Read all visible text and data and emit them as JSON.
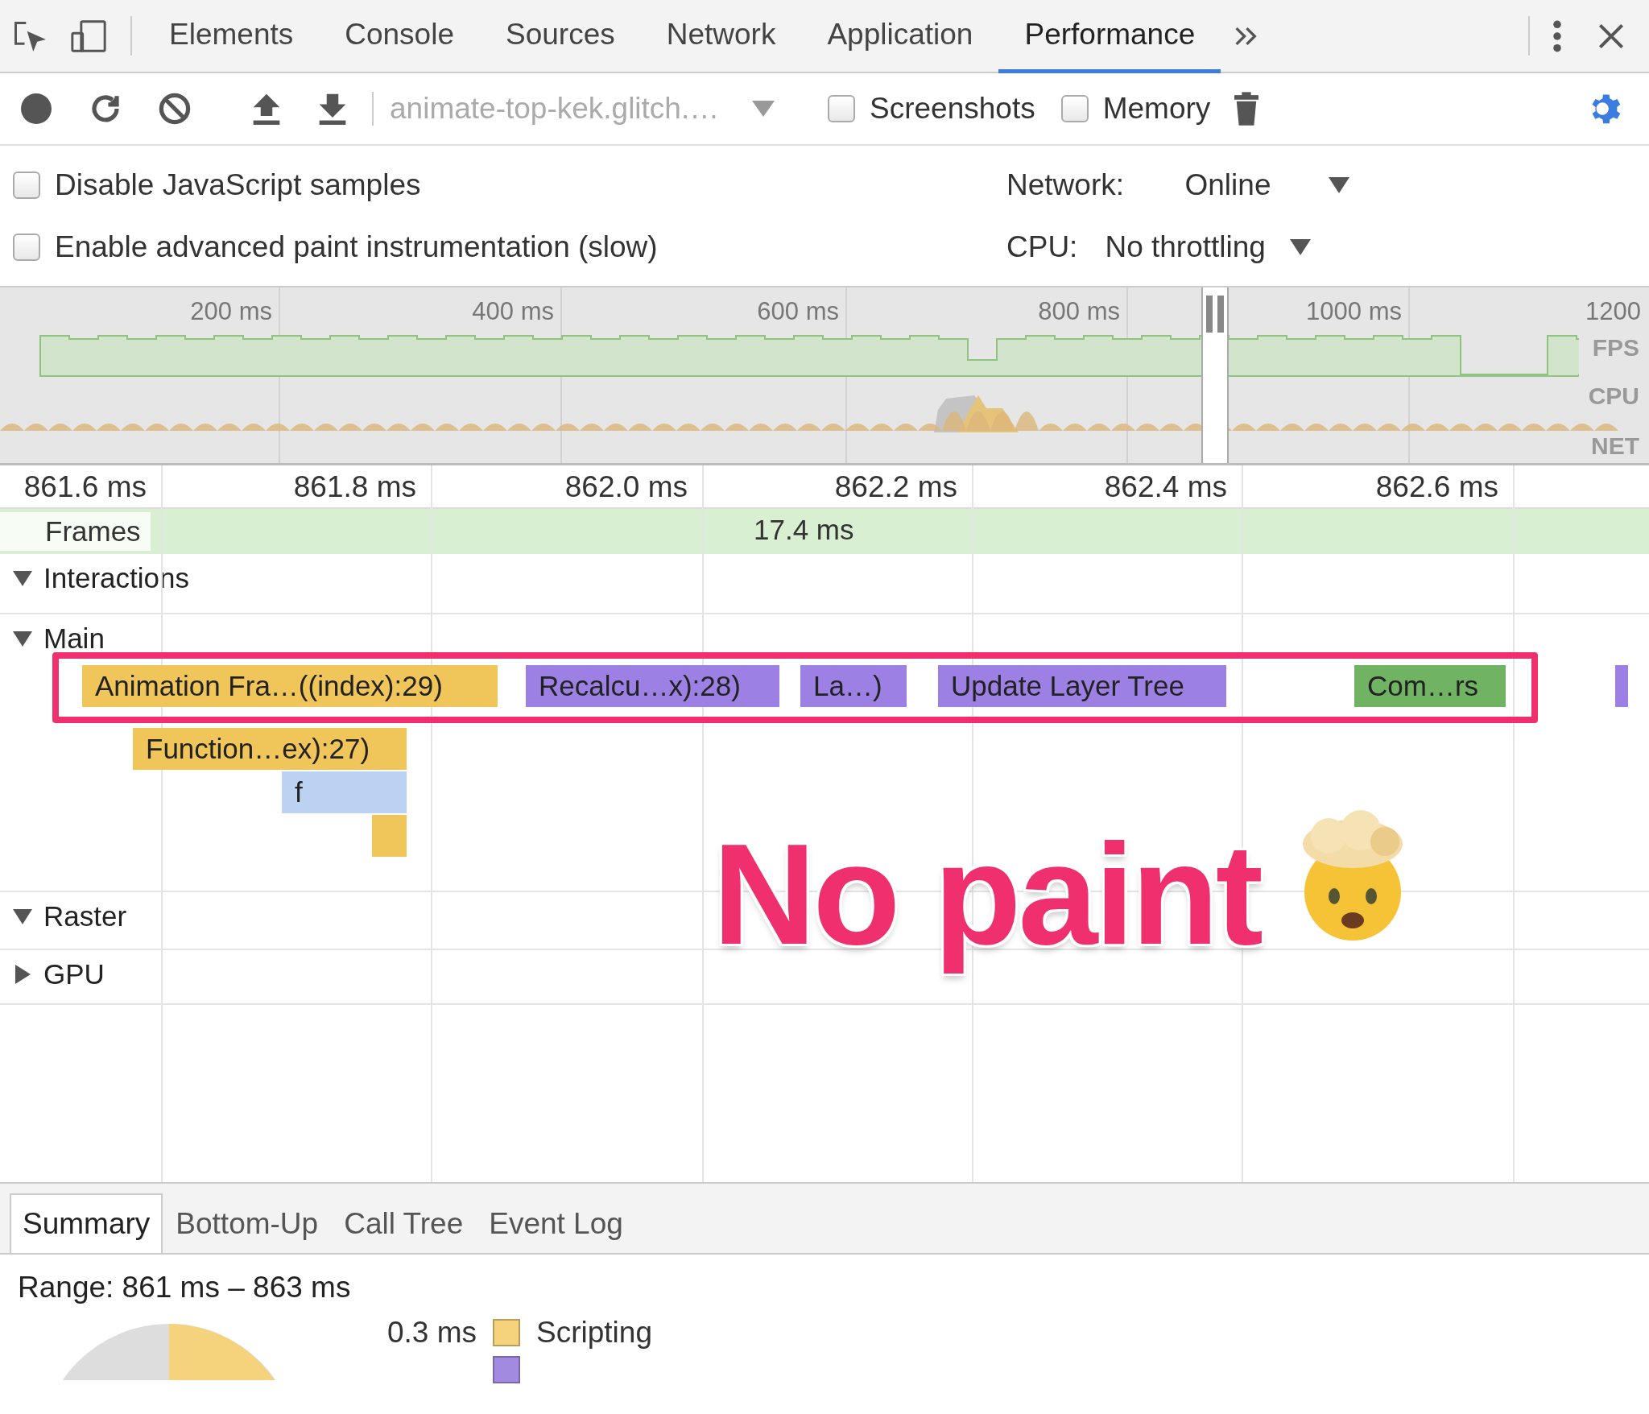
{
  "tabs": [
    {
      "label": "Elements",
      "selected": false
    },
    {
      "label": "Console",
      "selected": false
    },
    {
      "label": "Sources",
      "selected": false
    },
    {
      "label": "Network",
      "selected": false
    },
    {
      "label": "Application",
      "selected": false
    },
    {
      "label": "Performance",
      "selected": true
    }
  ],
  "toolbar": {
    "url": "animate-top-kek.glitch.…",
    "checkboxes": [
      {
        "label": "Screenshots",
        "checked": false
      },
      {
        "label": "Memory",
        "checked": false
      }
    ]
  },
  "settings": {
    "options": [
      {
        "label": "Disable JavaScript samples",
        "checked": false
      },
      {
        "label": "Enable advanced paint instrumentation (slow)",
        "checked": false
      }
    ],
    "selects": [
      {
        "label": "Network:",
        "value": "Online"
      },
      {
        "label": "CPU:",
        "value": "No throttling"
      }
    ]
  },
  "overview": {
    "ticks": [
      "200 ms",
      "400 ms",
      "600 ms",
      "800 ms",
      "1000 ms",
      "1200"
    ],
    "lanes": [
      "FPS",
      "CPU",
      "NET"
    ]
  },
  "timeline": {
    "ticks": [
      "861.6 ms",
      "861.8 ms",
      "862.0 ms",
      "862.2 ms",
      "862.4 ms",
      "862.6 ms"
    ],
    "tracks": [
      {
        "name": "Frames",
        "kind": "frames",
        "value": "17.4 ms"
      },
      {
        "name": "Interactions",
        "kind": "group",
        "expanded": true
      },
      {
        "name": "Main",
        "kind": "group",
        "expanded": true
      },
      {
        "name": "Raster",
        "kind": "group",
        "expanded": true
      },
      {
        "name": "GPU",
        "kind": "group",
        "expanded": false
      }
    ],
    "events": [
      {
        "label": "Animation Fra…((index):29)",
        "color": "#f0c55a"
      },
      {
        "label": "Recalcu…x):28)",
        "color": "#9d80e3"
      },
      {
        "label": "La…)",
        "color": "#9d80e3"
      },
      {
        "label": "Update Layer Tree",
        "color": "#9d80e3"
      },
      {
        "label": "Com…rs",
        "color": "#6fb363"
      },
      {
        "color": "#9d80e3"
      },
      {
        "label": "Function…ex):27)",
        "color": "#f0c55a"
      },
      {
        "label": "f",
        "color": "#bcd2f2"
      },
      {
        "color": "#f0c55a"
      }
    ]
  },
  "annotation": {
    "text": "No paint"
  },
  "summary": {
    "tabs": [
      {
        "label": "Summary",
        "selected": true
      },
      {
        "label": "Bottom-Up",
        "selected": false
      },
      {
        "label": "Call Tree",
        "selected": false
      },
      {
        "label": "Event Log",
        "selected": false
      }
    ],
    "range": "Range: 861 ms – 863 ms",
    "legend": [
      {
        "value": "0.3 ms",
        "label": "Scripting",
        "color": "#f4d37c"
      },
      {
        "color": "#a18be0"
      }
    ]
  }
}
